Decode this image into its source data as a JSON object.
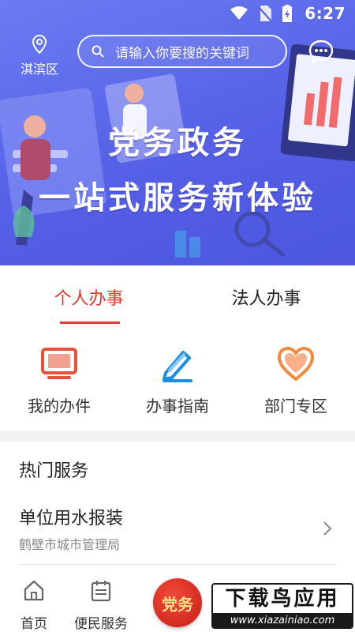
{
  "status_bar": {
    "time": "6:27"
  },
  "header": {
    "location": "淇滨区",
    "search_placeholder": "请输入你要搜的关键词"
  },
  "banner": {
    "line1": "党务政务",
    "line2": "一站式服务新体验"
  },
  "tabs": [
    {
      "label": "个人办事",
      "active": true
    },
    {
      "label": "法人办事",
      "active": false
    }
  ],
  "shortcuts": [
    {
      "label": "我的办件",
      "icon": "monitor-icon",
      "color": "#e8503a"
    },
    {
      "label": "办事指南",
      "icon": "pen-icon",
      "color": "#1e8fe0"
    },
    {
      "label": "部门专区",
      "icon": "heart-icon",
      "color": "#f08a3c"
    }
  ],
  "hot_services": {
    "title": "热门服务",
    "items": [
      {
        "title": "单位用水报装",
        "subtitle": "鹤壁市城市管理局"
      }
    ]
  },
  "bottom_nav": {
    "items": [
      {
        "label": "首页",
        "icon": "home-icon"
      },
      {
        "label": "便民服务",
        "icon": "calendar-icon"
      }
    ],
    "center_label": "党务"
  },
  "watermark": {
    "top": "下载鸟应用",
    "bottom": "www.xiazainiao.com"
  },
  "colors": {
    "accent": "#e23a2e",
    "banner": "#5a66e8"
  }
}
